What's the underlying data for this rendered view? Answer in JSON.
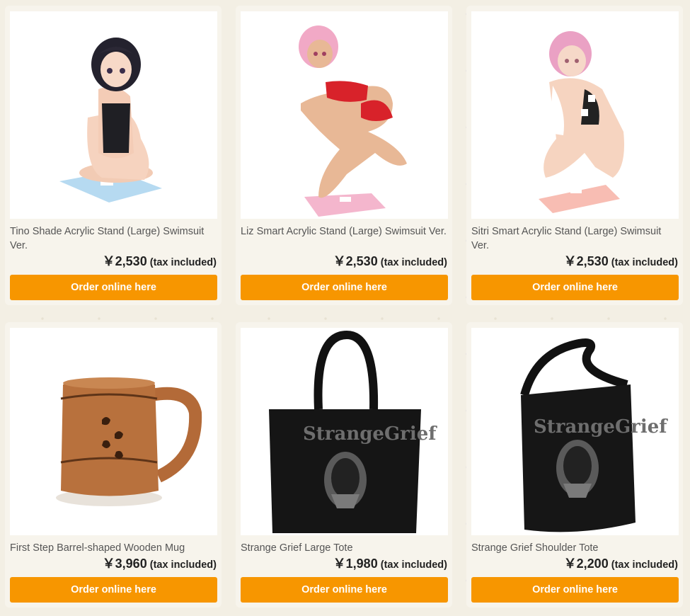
{
  "products": [
    {
      "name": "Tino Shade Acrylic Stand (Large) Swimsuit Ver.",
      "price": "￥2,530",
      "tax": "(tax included)",
      "button": "Order online here",
      "image": "acrylic-stand-tino-image"
    },
    {
      "name": "Liz Smart Acrylic Stand (Large) Swimsuit Ver.",
      "price": "￥2,530",
      "tax": "(tax included)",
      "button": "Order online here",
      "image": "acrylic-stand-liz-image"
    },
    {
      "name": "Sitri Smart Acrylic Stand (Large) Swimsuit Ver.",
      "price": "￥2,530",
      "tax": "(tax included)",
      "button": "Order online here",
      "image": "acrylic-stand-sitri-image"
    },
    {
      "name": "First Step Barrel-shaped Wooden Mug",
      "price": "￥3,960",
      "tax": "(tax included)",
      "button": "Order online here",
      "image": "wooden-mug-image"
    },
    {
      "name": "Strange Grief Large Tote",
      "price": "￥1,980",
      "tax": "(tax included)",
      "button": "Order online here",
      "image": "large-tote-image",
      "print_title": "StrangeGrief"
    },
    {
      "name": "Strange Grief Shoulder Tote",
      "price": "￥2,200",
      "tax": "(tax included)",
      "button": "Order online here",
      "image": "shoulder-tote-image",
      "print_title": "StrangeGrief"
    }
  ],
  "colors": {
    "button": "#f79600",
    "page_background": "#f3efe4",
    "card_background": "#f7f4ec"
  }
}
